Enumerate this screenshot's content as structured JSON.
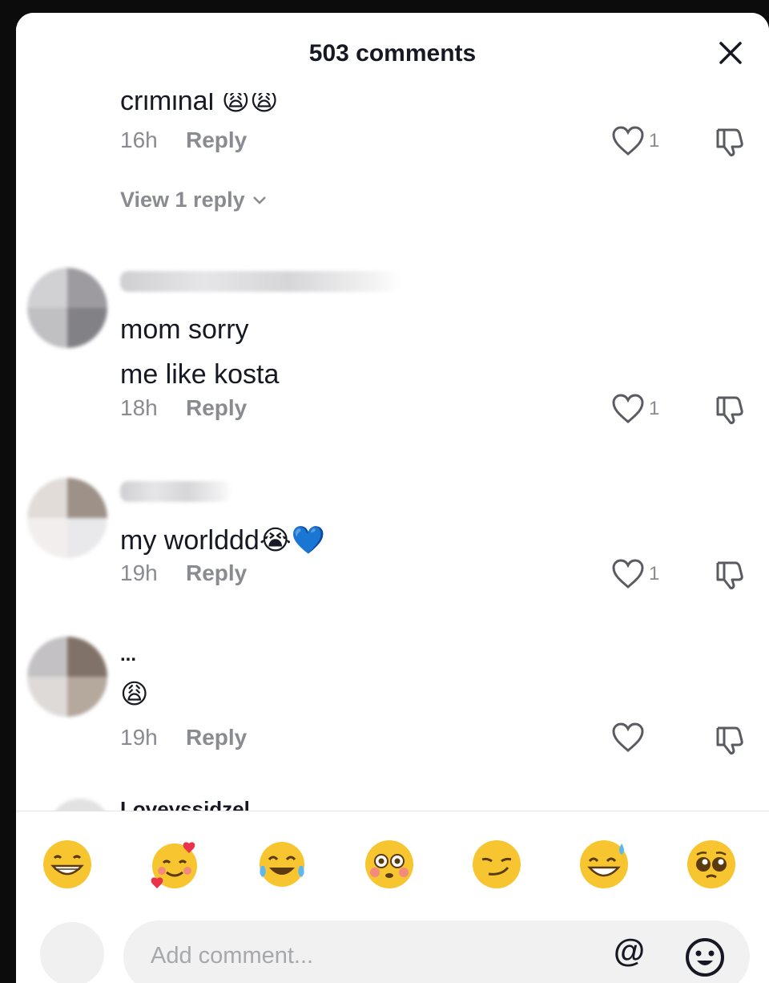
{
  "header": {
    "title": "503 comments",
    "close_icon": "close-icon"
  },
  "comments": [
    {
      "text": "criminal 😩😩",
      "time": "16h",
      "reply_label": "Reply",
      "likes": "1",
      "view_replies": "View 1 reply"
    },
    {
      "text_line1": "mom sorry",
      "text_line2": "me like kosta",
      "time": "18h",
      "reply_label": "Reply",
      "likes": "1"
    },
    {
      "text": "my worlddd😭💙",
      "time": "19h",
      "reply_label": "Reply",
      "likes": "1"
    },
    {
      "text_line1": "...",
      "emoji": "😩",
      "time": "19h",
      "reply_label": "Reply",
      "likes": ""
    },
    {
      "username": "Loveyssidzel"
    }
  ],
  "emoji_bar": [
    "😁",
    "🥰",
    "😂",
    "😳",
    "😏",
    "😅",
    "🥺"
  ],
  "compose": {
    "placeholder": "Add comment...",
    "at_label": "@"
  },
  "colors": {
    "text": "#161823",
    "muted": "#8a8b91",
    "input_bg": "#f1f1f2"
  }
}
